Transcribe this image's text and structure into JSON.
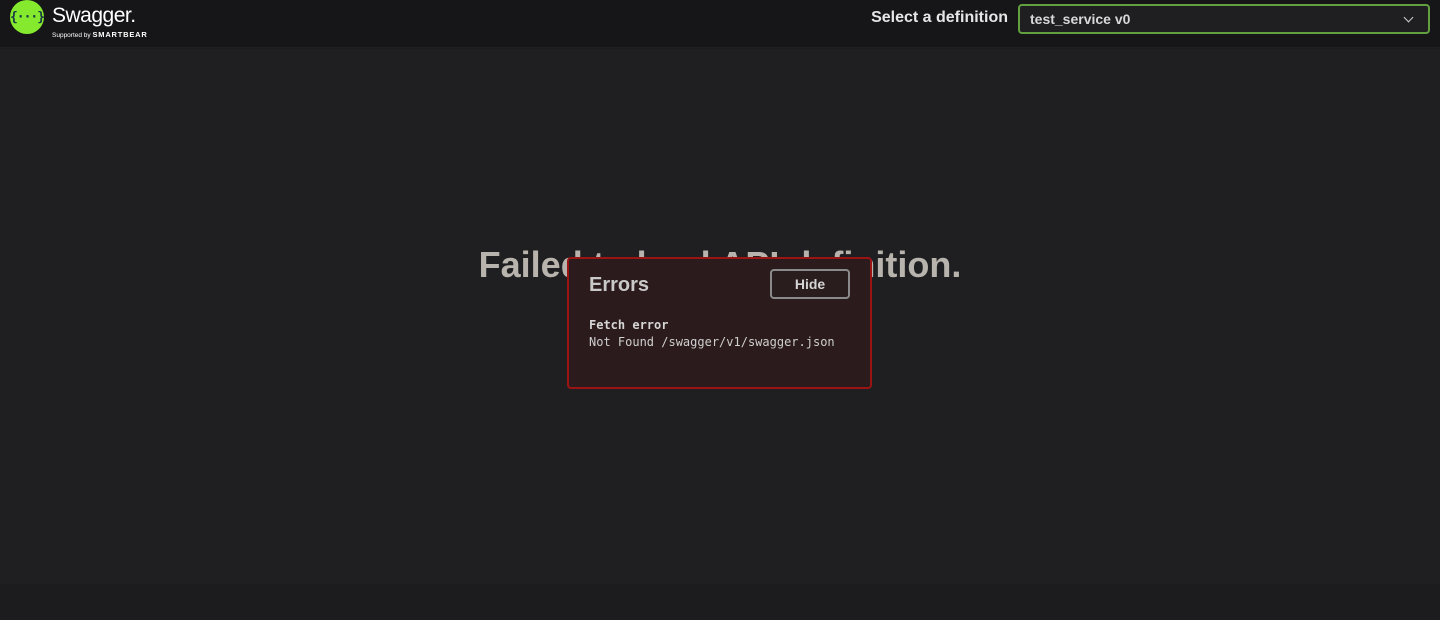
{
  "topbar": {
    "logo_glyph": "{···}",
    "logo_name": "Swagger.",
    "logo_sub_prefix": "Supported by ",
    "logo_sub_brand": "SMARTBEAR",
    "definition_label": "Select a definition",
    "definition_selected": "test_service v0",
    "accent_color": "#85ea2d",
    "select_border_color": "#62a03f"
  },
  "main": {
    "title": "Failed to load API definition.",
    "errors": {
      "heading": "Errors",
      "hide_label": "Hide",
      "error_type": "Fetch error",
      "error_message": "Not Found /swagger/v1/swagger.json",
      "border_color": "#9a1414"
    }
  }
}
